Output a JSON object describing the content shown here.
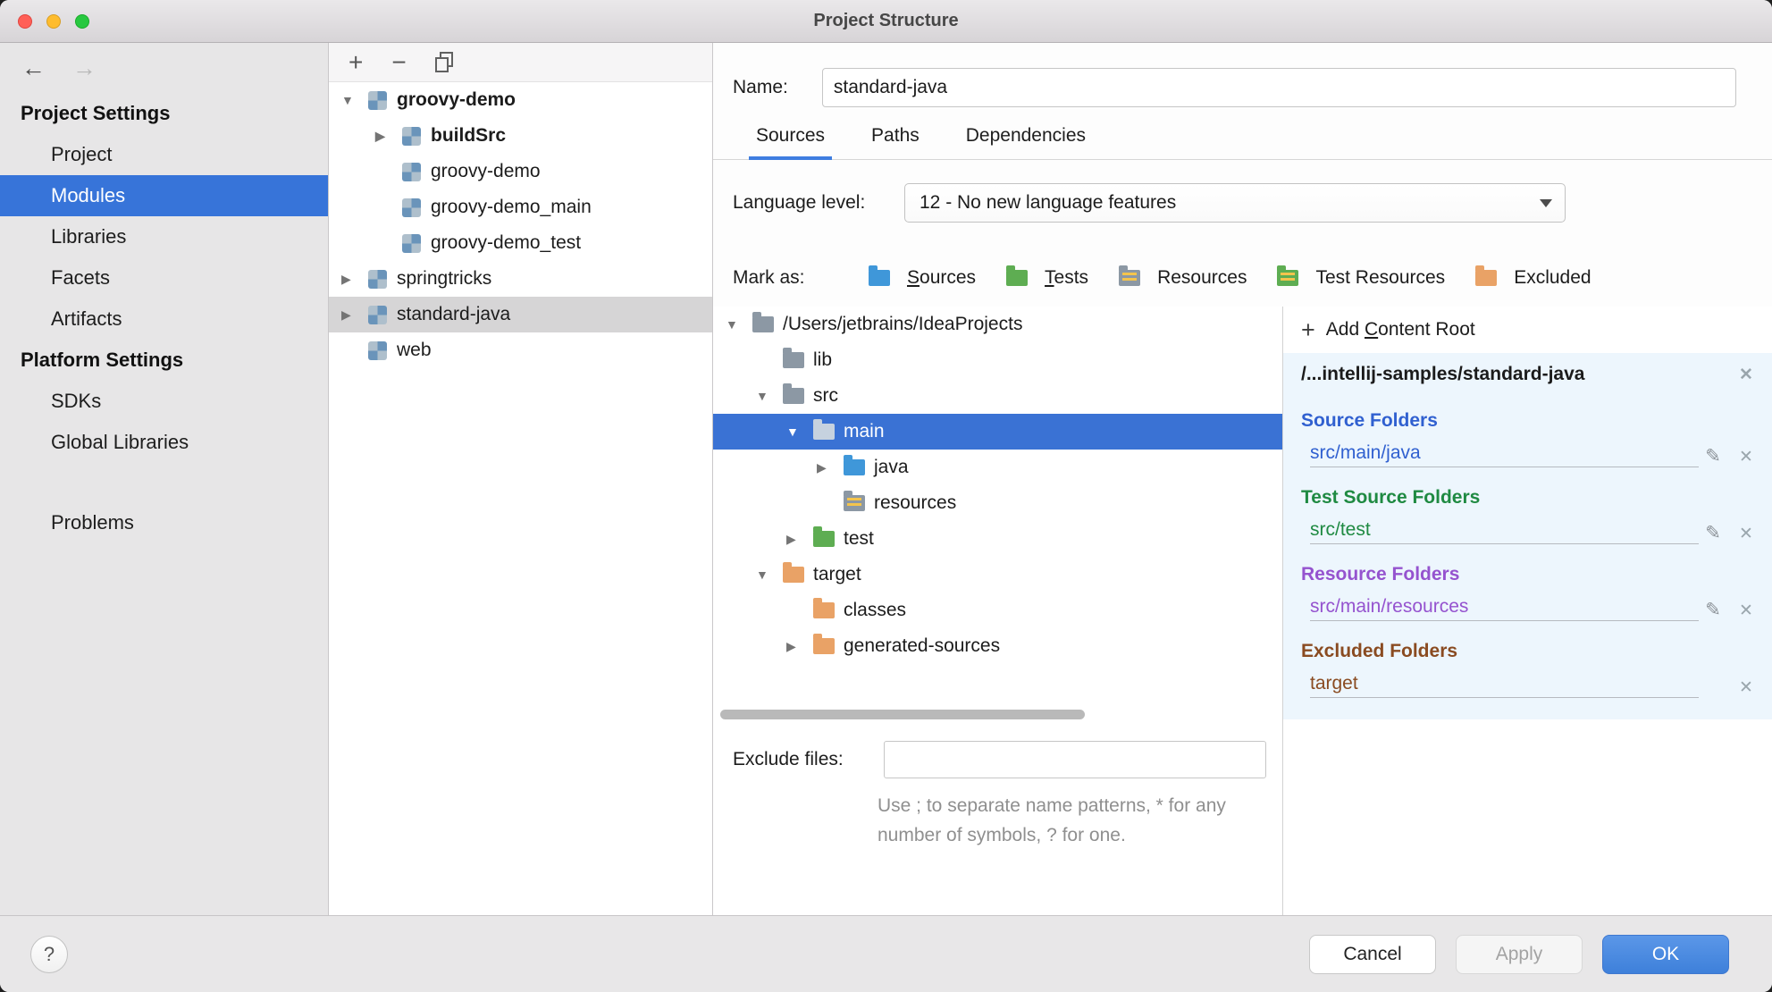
{
  "window": {
    "title": "Project Structure"
  },
  "sidebar": {
    "section1_header": "Project Settings",
    "section1_items": [
      "Project",
      "Modules",
      "Libraries",
      "Facets",
      "Artifacts"
    ],
    "section2_header": "Platform Settings",
    "section2_items": [
      "SDKs",
      "Global Libraries"
    ],
    "problems": "Problems",
    "selected_item": "Modules"
  },
  "modules_panel": {
    "items": [
      "groovy-demo",
      "buildSrc",
      "groovy-demo",
      "groovy-demo_main",
      "groovy-demo_test",
      "springtricks",
      "standard-java",
      "web"
    ],
    "selected_item": "standard-java"
  },
  "main": {
    "name_label": "Name:",
    "name_value": "standard-java",
    "tabs": [
      "Sources",
      "Paths",
      "Dependencies"
    ],
    "selected_tab": "Sources",
    "language_level_label": "Language level:",
    "language_level_value": "12 - No new language features",
    "mark_as_label": "Mark as:",
    "mark_sources_mnemonic": "S",
    "mark_sources_rest": "ources",
    "mark_tests_mnemonic": "T",
    "mark_tests_rest": "ests",
    "mark_resources": "Resources",
    "mark_test_resources": "Test Resources",
    "mark_excluded": "Excluded",
    "exclude_label": "Exclude files:",
    "exclude_value": "",
    "exclude_help": "Use ; to separate name patterns, * for any number of symbols, ? for one."
  },
  "file_tree": {
    "rows": [
      "/Users/jetbrains/IdeaProjects",
      "lib",
      "src",
      "main",
      "java",
      "resources",
      "test",
      "target",
      "classes",
      "generated-sources"
    ],
    "selected_row": "main"
  },
  "details": {
    "add_pre": "Add ",
    "add_mnemonic": "C",
    "add_rest": "ontent Root",
    "root_path": "/...intellij-samples/standard-java",
    "source_header": "Source Folders",
    "source_item": "src/main/java",
    "test_header": "Test Source Folders",
    "test_item": "src/test",
    "resource_header": "Resource Folders",
    "resource_item": "src/main/resources",
    "excluded_header": "Excluded Folders",
    "excluded_item": "target"
  },
  "footer": {
    "help": "?",
    "cancel": "Cancel",
    "apply": "Apply",
    "ok": "OK"
  },
  "colors": {
    "selection_blue": "#3a72d4",
    "sidebar_selection_blue": "#3774d9",
    "source_blue": "#3060d0",
    "test_green": "#1f8a42",
    "resource_purple": "#9553cf",
    "excluded_brown": "#8a4b21",
    "excluded_folder_orange": "#e9a266",
    "ok_button_blue": "#3e80da",
    "traffic_red": "#ff5f57",
    "traffic_yellow": "#febc2e",
    "traffic_green": "#28c840"
  }
}
